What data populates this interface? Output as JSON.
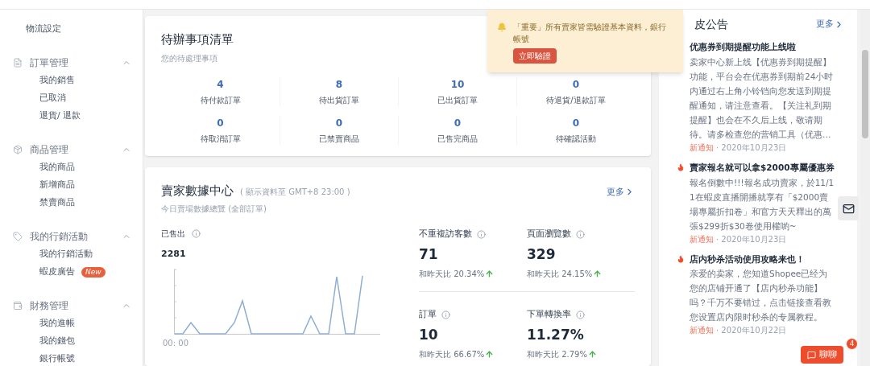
{
  "sidebar": {
    "top_item": "物流設定",
    "groups": [
      {
        "kind": "document",
        "title": "訂單管理",
        "expanded": true,
        "items": [
          {
            "label": "我的銷售"
          },
          {
            "label": "已取消"
          },
          {
            "label": "退貨/ 退款"
          }
        ]
      },
      {
        "kind": "box",
        "title": "商品管理",
        "expanded": true,
        "items": [
          {
            "label": "我的商品"
          },
          {
            "label": "新增商品"
          },
          {
            "label": "禁賣商品"
          }
        ]
      },
      {
        "kind": "tag",
        "title": "我的行銷活動",
        "expanded": true,
        "items": [
          {
            "label": "我的行銷活動"
          },
          {
            "label": "蝦皮廣告",
            "badge": "New"
          }
        ]
      },
      {
        "kind": "wallet",
        "title": "財務管理",
        "expanded": true,
        "items": [
          {
            "label": "我的進帳"
          },
          {
            "label": "我的錢包"
          },
          {
            "label": "銀行帳號"
          }
        ]
      }
    ]
  },
  "todo": {
    "title": "待辦事項清單",
    "subtitle": "您的待處理事項",
    "items": [
      {
        "value": "4",
        "label": "待付款訂單"
      },
      {
        "value": "8",
        "label": "待出貨訂單"
      },
      {
        "value": "10",
        "label": "已出貨訂單"
      },
      {
        "value": "0",
        "label": "待退貨/退款訂單"
      },
      {
        "value": "0",
        "label": "待取消訂單"
      },
      {
        "value": "0",
        "label": "已禁賣商品"
      },
      {
        "value": "0",
        "label": "已售完商品"
      },
      {
        "value": "0",
        "label": "待確認活動"
      }
    ]
  },
  "data_center": {
    "title": "賣家數據中心",
    "note": "( 顯示資料至 GMT+8 23:00 )",
    "subtitle": "今日賣場數據總覽 (全部訂單)",
    "more": "更多",
    "sold": {
      "label": "已售出",
      "value": "2281",
      "x_label": "00: 00"
    },
    "metrics": [
      {
        "label": "不重複訪客數",
        "value": "71",
        "compare": "和昨天比 20.34%"
      },
      {
        "label": "頁面瀏覽數",
        "value": "329",
        "compare": "和昨天比 24.15%"
      },
      {
        "label": "訂單",
        "value": "10",
        "compare": "和昨天比 66.67%"
      },
      {
        "label": "下單轉換率",
        "value": "11.27%",
        "compare": "和昨天比 2.79%"
      }
    ]
  },
  "alert": {
    "text": "「重要」所有賣家皆需驗證基本資料，銀行帳號",
    "button": "立即驗證"
  },
  "announcements": {
    "title": "皮公告",
    "more": "更多",
    "items": [
      {
        "hot": false,
        "title": "优惠券到期提醒功能上线啦",
        "body": "卖家中心新上线【优惠券到期提醒】功能，平台会在优惠券到期前24小时内通过右上角小铃铛向您发送到期提醒通知，请注意查看。【关注礼到期提醒】也会在不久后上线，敬请期待。请多检查您的营销工具（优惠…",
        "tag": "新通知",
        "date": "· 2020年10月23日"
      },
      {
        "hot": true,
        "title": "賣家報名就可以拿$2000專屬優惠券",
        "body": "報名倒數中!!!報名成功賣家，於11/11在蝦皮直播開播就享有「$2000賣場專屬折扣卷」和官方天天釋出的萬張$299折$30卷使用權喲~",
        "tag": "新通知",
        "date": "· 2020年10月23日"
      },
      {
        "hot": true,
        "title": "店内秒杀活动使用攻略来也！",
        "body": "亲爱的卖家，您知道Shopee已经为您的店铺开通了【店内秒杀功能】吗？千万不要错过，点击链接查看教您设置店内限时秒杀的专属教程。",
        "tag": "新通知",
        "date": "· 2020年10月22日"
      }
    ]
  },
  "chat": {
    "label": "聊聊",
    "badge": "4"
  }
}
